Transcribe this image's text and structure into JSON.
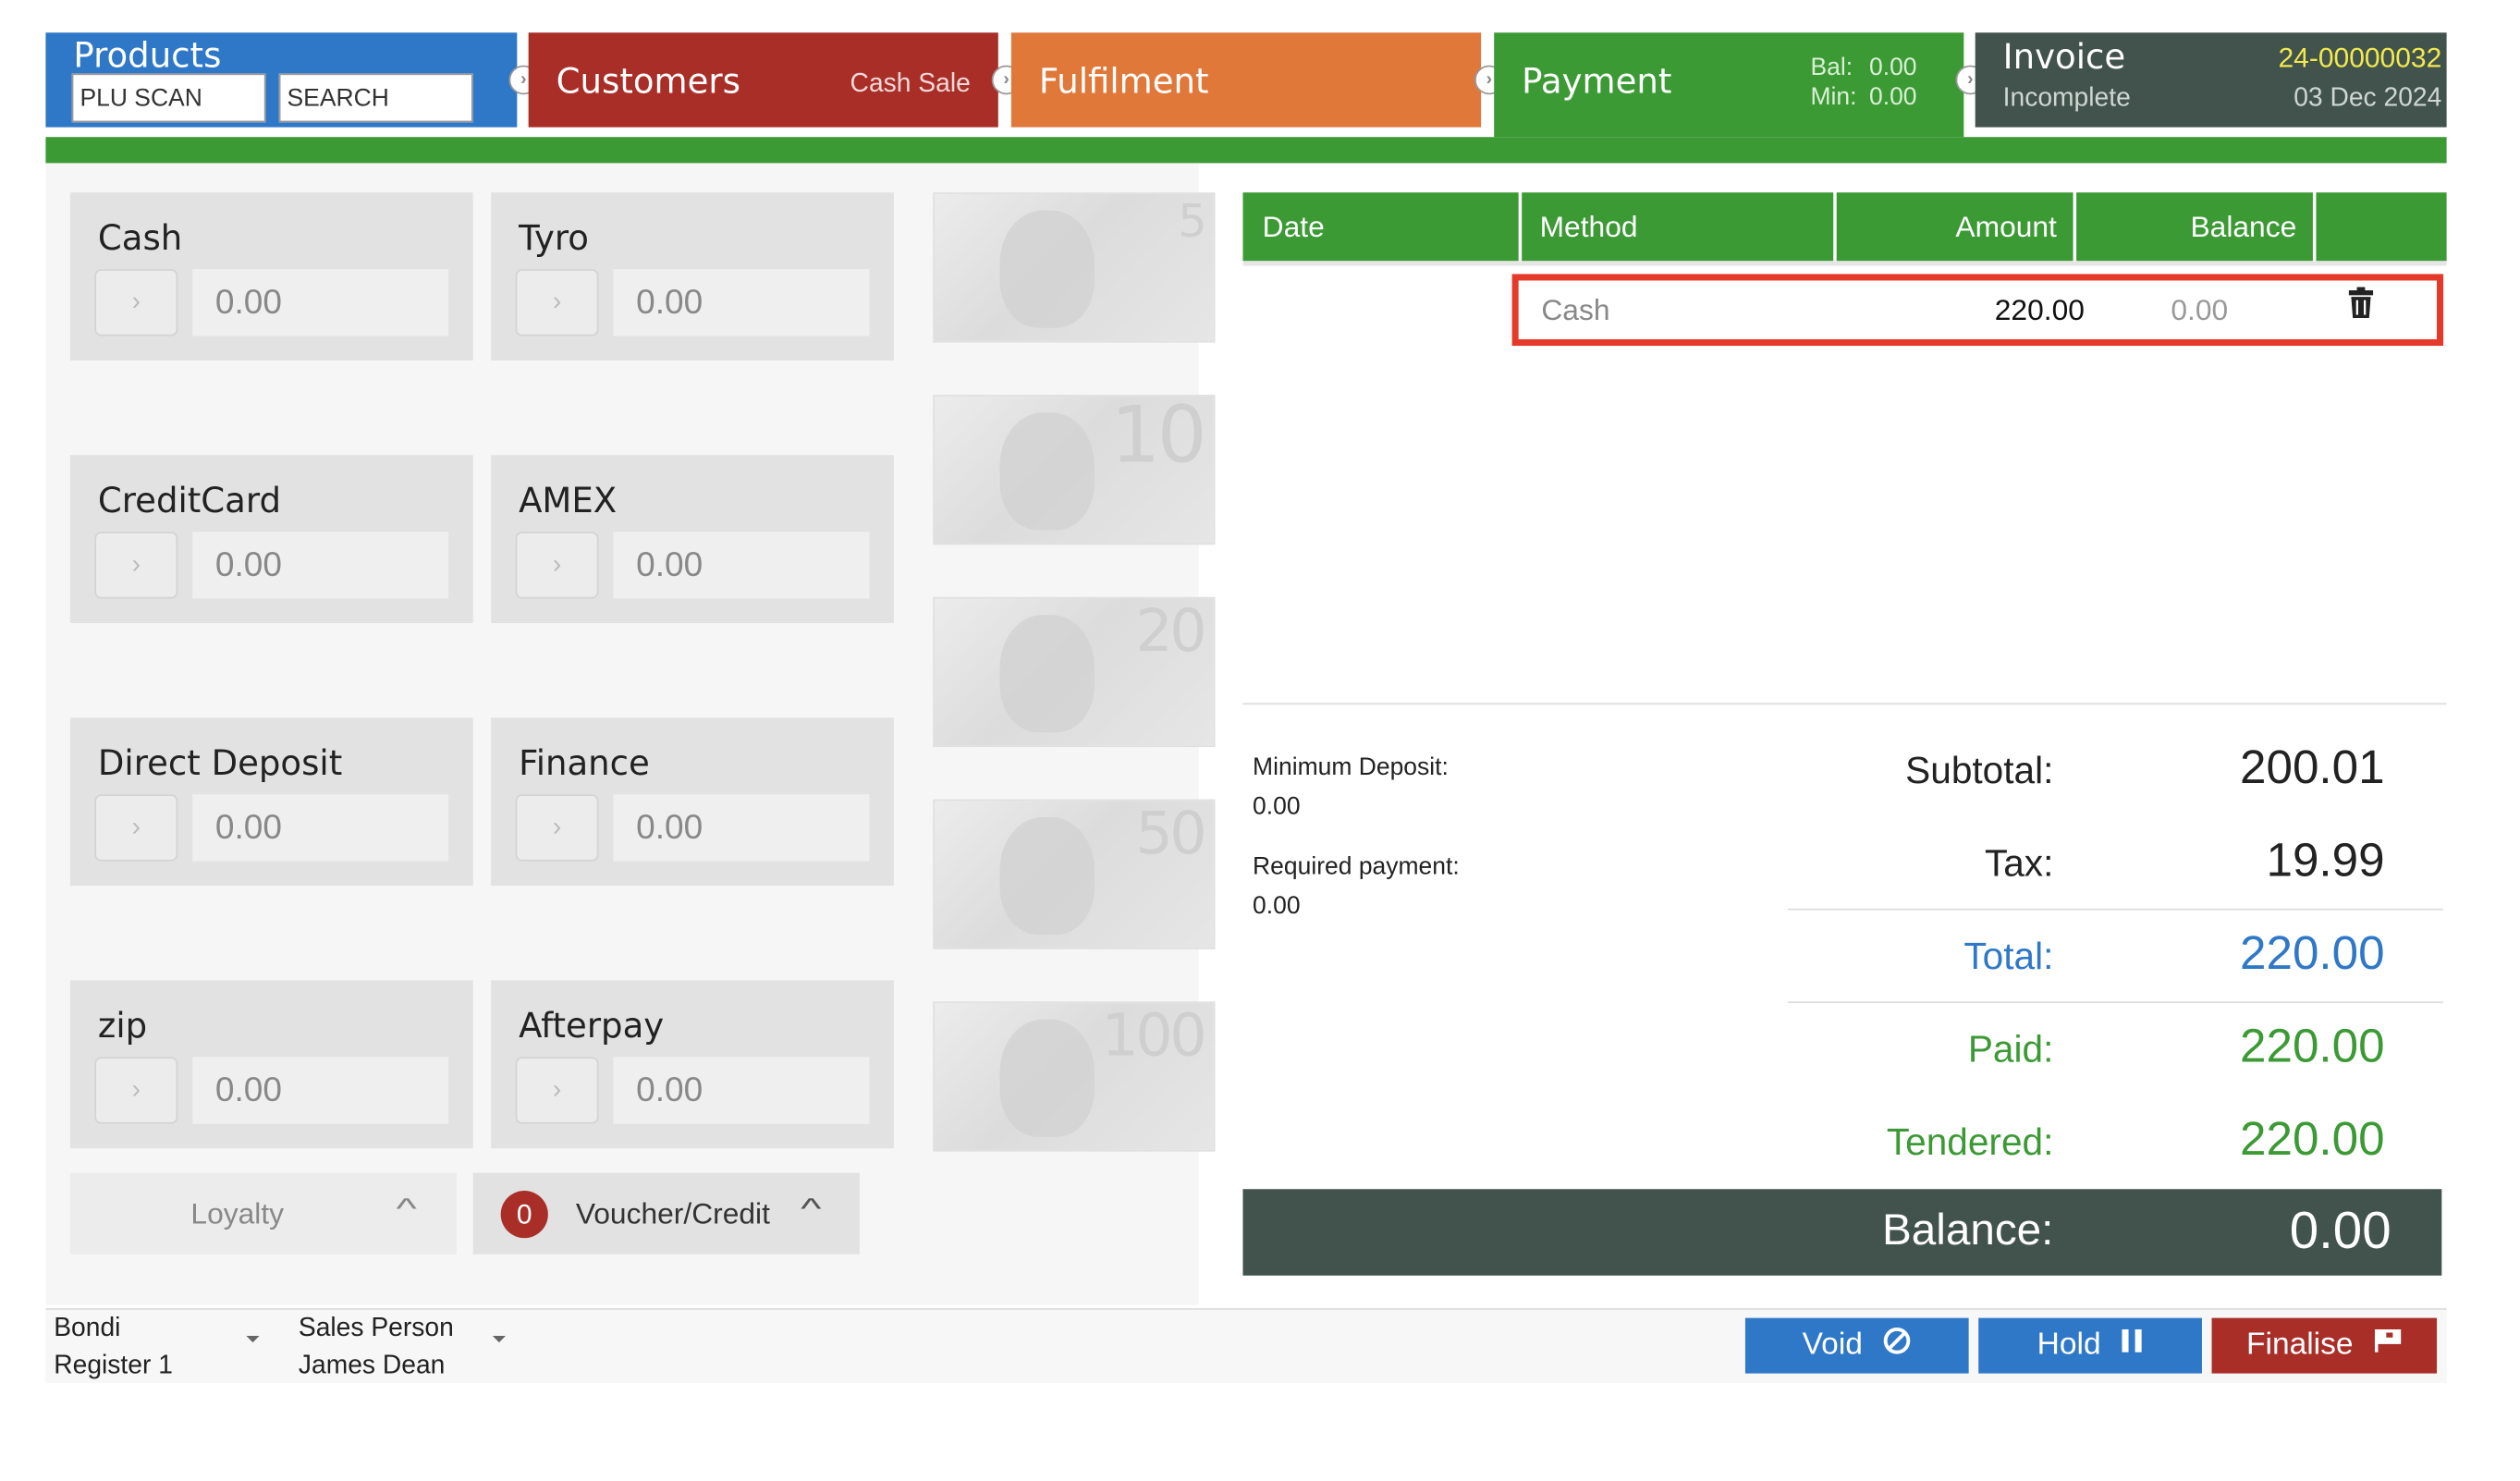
{
  "header": {
    "products": {
      "title": "Products",
      "plu_placeholder": "PLU SCAN",
      "search_placeholder": "SEARCH"
    },
    "customers": {
      "title": "Customers",
      "sub": "Cash Sale"
    },
    "fulfilment": {
      "title": "Fulfilment"
    },
    "payment": {
      "title": "Payment",
      "bal_label": "Bal:",
      "bal_value": "0.00",
      "min_label": "Min:",
      "min_value": "0.00"
    },
    "invoice": {
      "title": "Invoice",
      "number": "24-00000032",
      "status": "Incomplete",
      "date": "03 Dec 2024"
    }
  },
  "methods": [
    {
      "label": "Cash",
      "value": "0.00"
    },
    {
      "label": "Tyro",
      "value": "0.00"
    },
    {
      "label": "CreditCard",
      "value": "0.00"
    },
    {
      "label": "AMEX",
      "value": "0.00"
    },
    {
      "label": "Direct Deposit",
      "value": "0.00"
    },
    {
      "label": "Finance",
      "value": "0.00"
    },
    {
      "label": "zip",
      "value": "0.00"
    },
    {
      "label": "Afterpay",
      "value": "0.00"
    }
  ],
  "notes": [
    "5",
    "10",
    "20",
    "50",
    "100"
  ],
  "loyalty": {
    "label": "Loyalty"
  },
  "voucher": {
    "label": "Voucher/Credit",
    "count": "0"
  },
  "table": {
    "headers": {
      "date": "Date",
      "method": "Method",
      "amount": "Amount",
      "balance": "Balance"
    },
    "rows": [
      {
        "date": "",
        "method": "Cash",
        "amount": "220.00",
        "balance": "0.00"
      }
    ]
  },
  "deposit": {
    "min_label": "Minimum Deposit:",
    "min_value": "0.00",
    "req_label": "Required payment:",
    "req_value": "0.00"
  },
  "summary": {
    "subtotal_label": "Subtotal:",
    "subtotal": "200.01",
    "tax_label": "Tax:",
    "tax": "19.99",
    "total_label": "Total:",
    "total": "220.00",
    "paid_label": "Paid:",
    "paid": "220.00",
    "tendered_label": "Tendered:",
    "tendered": "220.00",
    "balance_label": "Balance:",
    "balance": "0.00"
  },
  "footer": {
    "store": "Bondi",
    "register": "Register 1",
    "sales_label": "Sales Person",
    "sales_person": "James Dean",
    "void": "Void",
    "hold": "Hold",
    "finalise": "Finalise"
  },
  "colors": {
    "blue": "#2f78c7",
    "red": "#a92e28",
    "orange": "#e0783a",
    "green": "#3c9a35",
    "dark": "#41534c",
    "yellow": "#f2e94e",
    "highlight": "#e53a2a"
  }
}
